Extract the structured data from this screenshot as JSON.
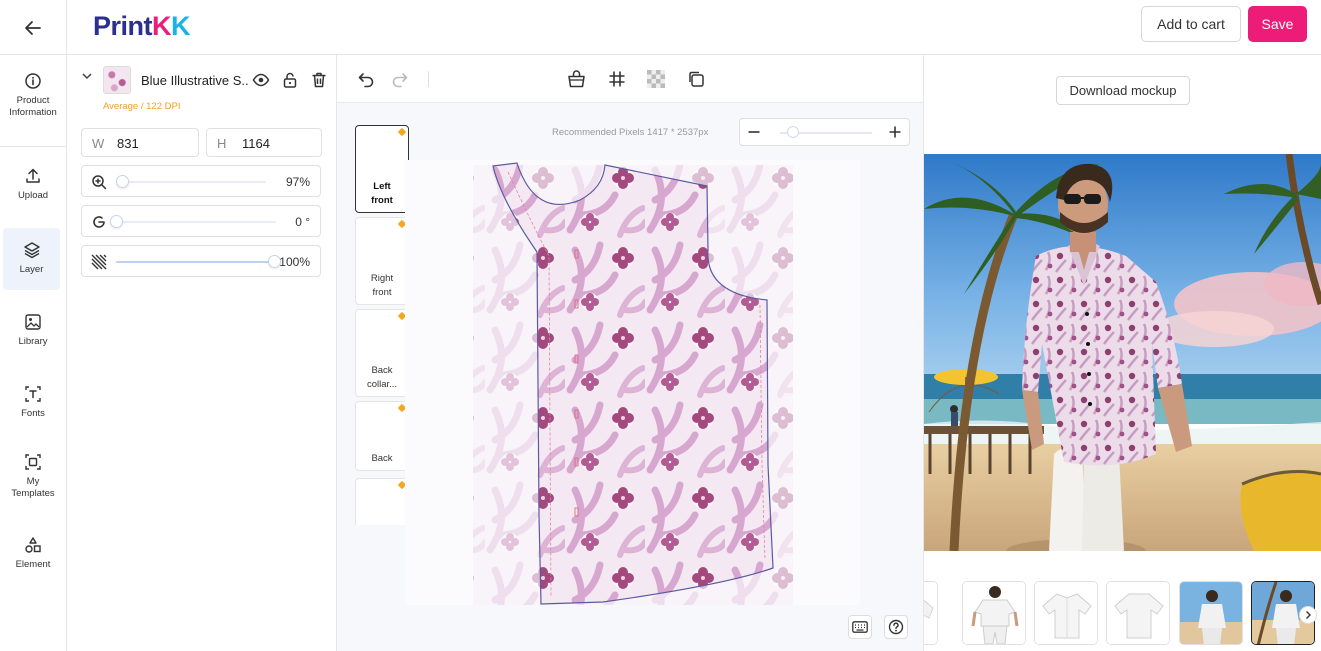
{
  "header": {
    "logo": {
      "part1": "Print",
      "part2": "K",
      "part3": "K"
    },
    "add_to_cart": "Add to cart",
    "save": "Save"
  },
  "nav": {
    "items": [
      {
        "label": "Product Information",
        "icon": "info-icon"
      },
      {
        "label": "Upload",
        "icon": "upload-icon"
      },
      {
        "label": "Layer",
        "icon": "layers-icon",
        "active": true
      },
      {
        "label": "Library",
        "icon": "image-icon"
      },
      {
        "label": "Fonts",
        "icon": "text-icon"
      },
      {
        "label": "My Templates",
        "icon": "template-icon"
      },
      {
        "label": "Element",
        "icon": "shapes-icon"
      }
    ]
  },
  "layer": {
    "name": "Blue Illustrative S...",
    "dpi_note": "Average / 122 DPI",
    "width_key": "W",
    "width": "831",
    "height_key": "H",
    "height": "1164",
    "scale": "97%",
    "scale_level": 0.03,
    "rotation": "0 °",
    "rotation_level": 0.0,
    "opacity": "100%",
    "opacity_level": 1.0
  },
  "editor": {
    "recommended": "Recommended Pixels 1417 * 2537px",
    "zoom_level": 0.08,
    "parts": [
      {
        "label": "Left front",
        "active": true
      },
      {
        "label": "Right front"
      },
      {
        "label": "Back collar..."
      },
      {
        "label": "Back"
      },
      {
        "label": ""
      }
    ]
  },
  "mockup": {
    "download": "Download mockup"
  },
  "colors": {
    "brand_pink": "#ec1c78",
    "brand_navy": "#2b2f8f",
    "brand_cyan": "#19b3e6",
    "dpi_warning": "#f0a020",
    "pattern_dark": "#a4497e",
    "pattern_light": "#d9a8cf"
  }
}
